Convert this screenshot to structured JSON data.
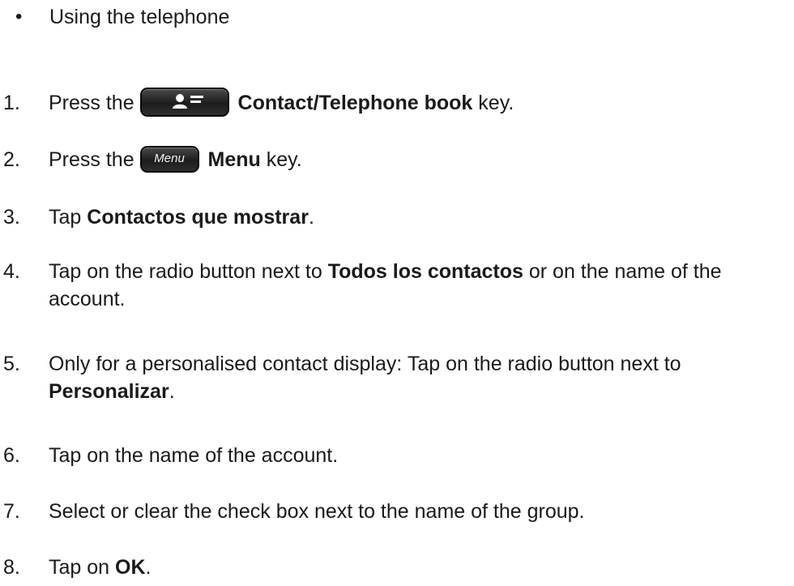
{
  "bullet": {
    "symbol": "•",
    "text": "Using the telephone"
  },
  "steps": [
    {
      "number": "1.",
      "pre": "Press the",
      "key_icon": "contact-telephone-book-key-icon",
      "bold": "Contact/Telephone book",
      "post": " key."
    },
    {
      "number": "2.",
      "pre": "Press the",
      "key_icon": "menu-key-icon",
      "key_label": "Menu",
      "bold": "Menu",
      "post": " key."
    },
    {
      "number": "3.",
      "pre": "Tap ",
      "bold": "Contactos que mostrar",
      "post": "."
    },
    {
      "number": "4.",
      "pre": "Tap on the radio button next to ",
      "bold": "Todos los contactos",
      "post": " or on the name of the account."
    },
    {
      "number": "5.",
      "pre": "Only for a personalised contact display: Tap on the radio button next to ",
      "bold": "Personalizar",
      "post": "."
    },
    {
      "number": "6.",
      "text": "Tap on the name of the account."
    },
    {
      "number": "7.",
      "text": "Select or clear the check box next to the name of the group."
    },
    {
      "number": "8.",
      "pre": "Tap on ",
      "bold": "OK",
      "post": "."
    }
  ]
}
